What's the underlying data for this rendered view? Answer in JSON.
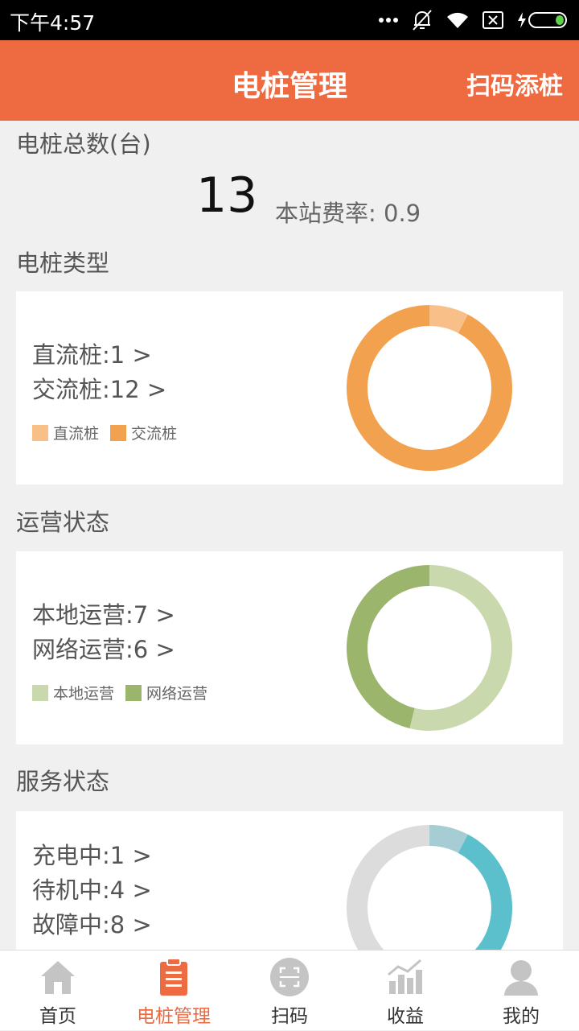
{
  "status_bar": {
    "time": "下午4:57"
  },
  "header": {
    "title": "电桩管理",
    "action": "扫码添桩"
  },
  "summary": {
    "total_label": "电桩总数(台)",
    "total_value": "13",
    "rate_text": "本站费率: 0.9"
  },
  "sections": {
    "type": {
      "label": "电桩类型",
      "lines": [
        "直流桩:1 >",
        "交流桩:12 >"
      ],
      "legend": [
        {
          "label": "直流桩",
          "color": "#f8c088"
        },
        {
          "label": "交流桩",
          "color": "#f2a14e"
        }
      ],
      "chart": {
        "values": [
          1,
          12
        ],
        "colors": [
          "#f8c088",
          "#f2a14e"
        ]
      }
    },
    "operation": {
      "label": "运营状态",
      "lines": [
        "本地运营:7 >",
        "网络运营:6 >"
      ],
      "legend": [
        {
          "label": "本地运营",
          "color": "#c9d8ad"
        },
        {
          "label": "网络运营",
          "color": "#9bb56c"
        }
      ],
      "chart": {
        "values": [
          7,
          6
        ],
        "colors": [
          "#c9d8ad",
          "#9bb56c"
        ]
      }
    },
    "service": {
      "label": "服务状态",
      "lines": [
        "充电中:1 >",
        "待机中:4 >",
        "故障中:8 >"
      ],
      "chart": {
        "values": [
          1,
          4,
          8
        ],
        "colors": [
          "#a6ccd4",
          "#5bbfcc",
          "#dcdcdc"
        ]
      }
    }
  },
  "tabs": [
    {
      "label": "首页",
      "icon": "home-icon"
    },
    {
      "label": "电桩管理",
      "icon": "clipboard-icon",
      "active": true
    },
    {
      "label": "扫码",
      "icon": "scan-icon"
    },
    {
      "label": "收益",
      "icon": "chart-icon"
    },
    {
      "label": "我的",
      "icon": "user-icon"
    }
  ],
  "colors": {
    "accent": "#ee6b42",
    "tab_inactive": "#c4c4c4"
  }
}
